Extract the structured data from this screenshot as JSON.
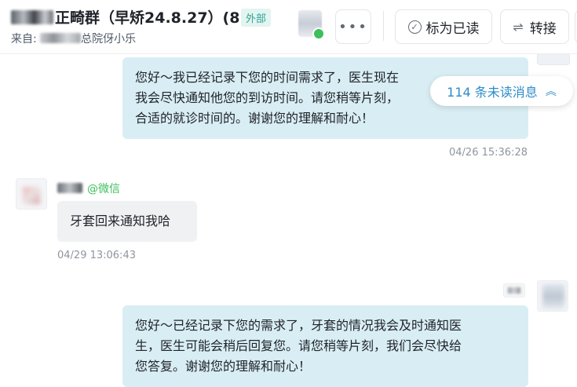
{
  "header": {
    "title_prefix": "",
    "title": "正畸群（早矫24.8.27）(8)",
    "external_badge": "外部",
    "subtitle_prefix": "来自: ",
    "subtitle_suffix": "总院伢小乐",
    "more_label": "•••",
    "mark_read_label": "标为已读",
    "transfer_label": "转接"
  },
  "unread": {
    "label": "114 条未读消息"
  },
  "messages": [
    {
      "direction": "outgoing",
      "lines": [
        "您好～我已经记录下您的时间需求了，医生现在",
        "我会尽快通知他您的到访时间。请您稍等片刻，",
        "合适的就诊时间的。谢谢您的理解和耐心！"
      ],
      "time": "04/26 15:36:28"
    },
    {
      "direction": "incoming",
      "sender_suffix": "@微信",
      "text": "牙套回来通知我哈",
      "time": "04/29 13:06:43"
    },
    {
      "direction": "outgoing",
      "lines": [
        "您好～已经记录下您的需求了，牙套的情况我会及时通知医",
        "生，医生可能会稍后回复您。请您稍等片刻，我们会尽快给",
        "您答复。谢谢您的理解和耐心！"
      ]
    }
  ],
  "colors": {
    "outgoing_bubble": "#d9eef4",
    "incoming_bubble": "#f0f1f3",
    "accent": "#2c8cc9",
    "wechat_green": "#3dbf5a",
    "external_badge": "#2fa394"
  }
}
